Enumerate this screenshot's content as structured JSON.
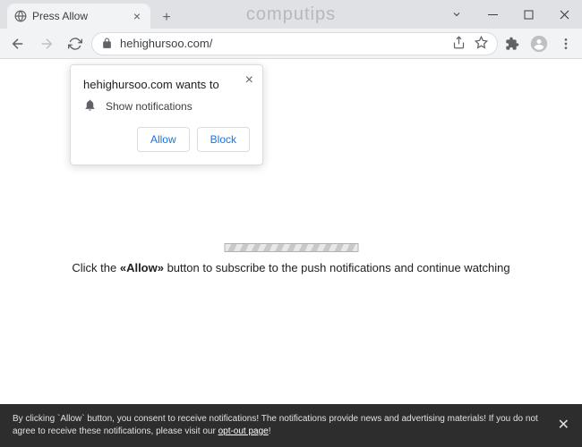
{
  "window": {
    "watermark": "computips"
  },
  "tab": {
    "title": "Press Allow"
  },
  "omnibox": {
    "url": "hehighursoo.com/"
  },
  "permission": {
    "title": "hehighursoo.com wants to",
    "capability": "Show notifications",
    "allow_label": "Allow",
    "block_label": "Block"
  },
  "page": {
    "msg_prefix": "Click the ",
    "msg_bold": "«Allow»",
    "msg_suffix": " button to subscribe to the push notifications and continue watching"
  },
  "banner": {
    "text_before": "By clicking `Allow` button, you consent to receive notifications! The notifications provide news and advertising materials! If you do not agree to receive these notifications, please visit our ",
    "link_text": "opt-out page",
    "text_after": "!"
  }
}
